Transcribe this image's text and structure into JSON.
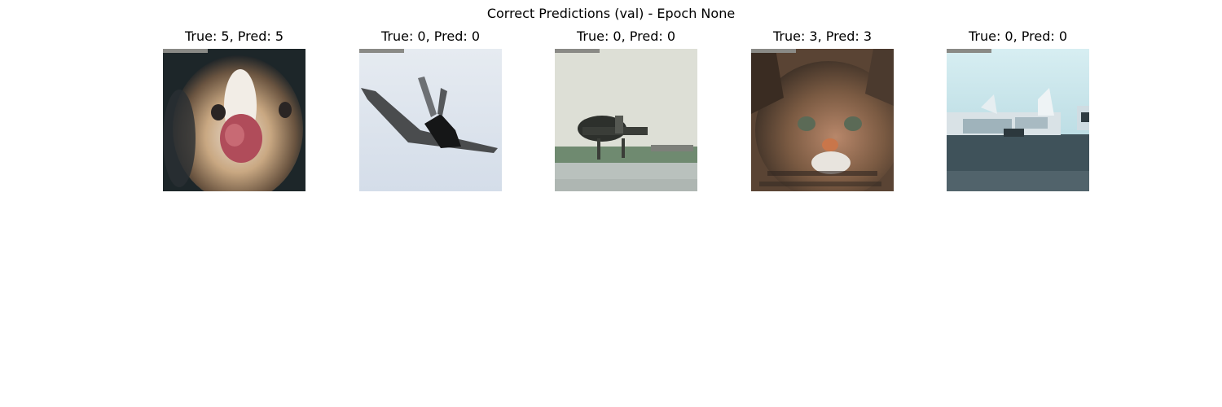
{
  "figure": {
    "title": "Correct Predictions (val) - Epoch None"
  },
  "panels": [
    {
      "title": "True: 5, Pred: 5",
      "image": "dog-face-thumbnail"
    },
    {
      "title": "True: 0, Pred: 0",
      "image": "airplane-in-sky-thumbnail"
    },
    {
      "title": "True: 0, Pred: 0",
      "image": "airplane-on-runway-thumbnail"
    },
    {
      "title": "True: 3, Pred: 3",
      "image": "cat-face-thumbnail"
    },
    {
      "title": "True: 0, Pred: 0",
      "image": "jets-on-tarmac-thumbnail"
    }
  ],
  "colors": {
    "background": "#ffffff",
    "indicator_bar": "#8a8a86"
  }
}
